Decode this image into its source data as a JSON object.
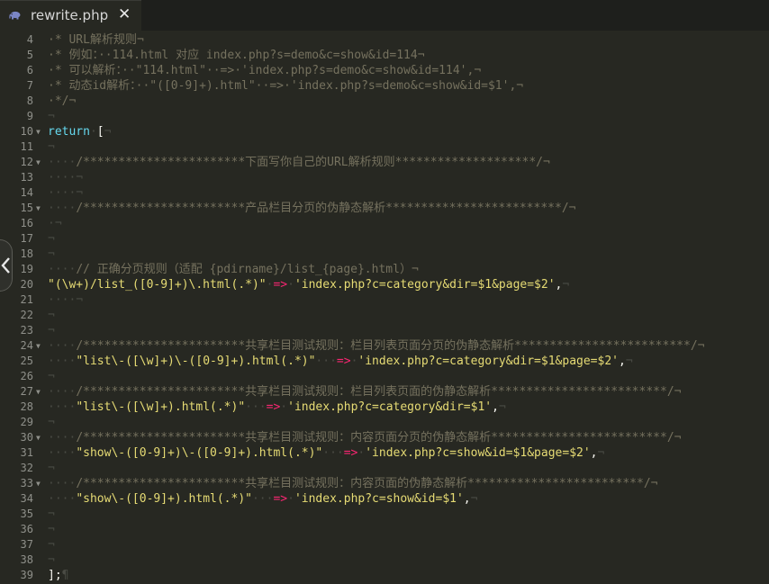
{
  "tab": {
    "filename": "rewrite.php",
    "icon": "php-elephant-icon",
    "close_label": "✕"
  },
  "theme": {
    "background": "#272822",
    "comment": "#75715e",
    "keyword": "#66d9ef",
    "string": "#e6db74",
    "operator": "#f92672"
  },
  "lines": [
    {
      "num": "4",
      "fold": "",
      "tokens": [
        [
          "cm",
          "·* URL解析规则¬"
        ]
      ]
    },
    {
      "num": "5",
      "fold": "",
      "tokens": [
        [
          "cm",
          "·* 例如：··114.html 对应 index.php?s=demo&c=show&id=114¬"
        ]
      ]
    },
    {
      "num": "6",
      "fold": "",
      "tokens": [
        [
          "cm",
          "·* 可以解析：··\"114.html\"··=>·'index.php?s=demo&c=show&id=114',¬"
        ]
      ]
    },
    {
      "num": "7",
      "fold": "",
      "tokens": [
        [
          "cm",
          "·* 动态id解析：··\"([0-9]+).html\"··=>·'index.php?s=demo&c=show&id=$1',¬"
        ]
      ]
    },
    {
      "num": "8",
      "fold": "",
      "tokens": [
        [
          "cm",
          "·*/¬"
        ]
      ]
    },
    {
      "num": "9",
      "fold": "",
      "tokens": [
        [
          "ws",
          "¬"
        ]
      ]
    },
    {
      "num": "10",
      "fold": "▼",
      "tokens": [
        [
          "kw",
          "return"
        ],
        [
          "ws",
          "·"
        ],
        [
          "p",
          "["
        ],
        [
          "ws",
          "¬"
        ]
      ]
    },
    {
      "num": "11",
      "fold": "",
      "tokens": [
        [
          "ws",
          "¬"
        ]
      ]
    },
    {
      "num": "12",
      "fold": "▼",
      "tokens": [
        [
          "ws",
          "····"
        ],
        [
          "cm",
          "/***********************下面写你自己的URL解析规则********************/¬"
        ]
      ]
    },
    {
      "num": "13",
      "fold": "",
      "tokens": [
        [
          "ws",
          "····¬"
        ]
      ]
    },
    {
      "num": "14",
      "fold": "",
      "tokens": [
        [
          "ws",
          "····¬"
        ]
      ]
    },
    {
      "num": "15",
      "fold": "▼",
      "tokens": [
        [
          "ws",
          "····"
        ],
        [
          "cm",
          "/***********************产品栏目分页的伪静态解析*************************/¬"
        ]
      ]
    },
    {
      "num": "16",
      "fold": "",
      "tokens": [
        [
          "ws",
          "·¬"
        ]
      ]
    },
    {
      "num": "17",
      "fold": "",
      "tokens": [
        [
          "ws",
          "¬"
        ]
      ]
    },
    {
      "num": "18",
      "fold": "",
      "tokens": [
        [
          "ws",
          "¬"
        ]
      ]
    },
    {
      "num": "19",
      "fold": "",
      "tokens": [
        [
          "ws",
          "····"
        ],
        [
          "cm",
          "// 正确分页规则（适配 {pdirname}/list_{page}.html）¬"
        ]
      ]
    },
    {
      "num": "20",
      "fold": "",
      "tokens": [
        [
          "s",
          "\"(\\w+)/list_([0-9]+)\\.html(.*)\""
        ],
        [
          "ws",
          "·"
        ],
        [
          "op",
          "=>"
        ],
        [
          "ws",
          "·"
        ],
        [
          "s",
          "'index.php?c=category&dir=$1&page=$2'"
        ],
        [
          "p",
          ","
        ],
        [
          "ws",
          "¬"
        ]
      ]
    },
    {
      "num": "21",
      "fold": "",
      "tokens": [
        [
          "ws",
          "····¬"
        ]
      ]
    },
    {
      "num": "22",
      "fold": "",
      "tokens": [
        [
          "ws",
          "¬"
        ]
      ]
    },
    {
      "num": "23",
      "fold": "",
      "tokens": [
        [
          "ws",
          "¬"
        ]
      ]
    },
    {
      "num": "24",
      "fold": "▼",
      "tokens": [
        [
          "ws",
          "····"
        ],
        [
          "cm",
          "/***********************共享栏目测试规则：栏目列表页面分页的伪静态解析*************************/¬"
        ]
      ]
    },
    {
      "num": "25",
      "fold": "",
      "tokens": [
        [
          "ws",
          "····"
        ],
        [
          "s",
          "\"list\\-([\\w]+)\\-([0-9]+).html(.*)\""
        ],
        [
          "ws",
          "···"
        ],
        [
          "op",
          "=>"
        ],
        [
          "ws",
          "·"
        ],
        [
          "s",
          "'index.php?c=category&dir=$1&page=$2'"
        ],
        [
          "p",
          ","
        ],
        [
          "ws",
          "¬"
        ]
      ]
    },
    {
      "num": "26",
      "fold": "",
      "tokens": [
        [
          "ws",
          "¬"
        ]
      ]
    },
    {
      "num": "27",
      "fold": "▼",
      "tokens": [
        [
          "ws",
          "····"
        ],
        [
          "cm",
          "/***********************共享栏目测试规则：栏目列表页面的伪静态解析*************************/¬"
        ]
      ]
    },
    {
      "num": "28",
      "fold": "",
      "tokens": [
        [
          "ws",
          "····"
        ],
        [
          "s",
          "\"list\\-([\\w]+).html(.*)\""
        ],
        [
          "ws",
          "···"
        ],
        [
          "op",
          "=>"
        ],
        [
          "ws",
          "·"
        ],
        [
          "s",
          "'index.php?c=category&dir=$1'"
        ],
        [
          "p",
          ","
        ],
        [
          "ws",
          "¬"
        ]
      ]
    },
    {
      "num": "29",
      "fold": "",
      "tokens": [
        [
          "ws",
          "¬"
        ]
      ]
    },
    {
      "num": "30",
      "fold": "▼",
      "tokens": [
        [
          "ws",
          "····"
        ],
        [
          "cm",
          "/***********************共享栏目测试规则：内容页面分页的伪静态解析*************************/¬"
        ]
      ]
    },
    {
      "num": "31",
      "fold": "",
      "tokens": [
        [
          "ws",
          "····"
        ],
        [
          "s",
          "\"show\\-([0-9]+)\\-([0-9]+).html(.*)\""
        ],
        [
          "ws",
          "···"
        ],
        [
          "op",
          "=>"
        ],
        [
          "ws",
          "·"
        ],
        [
          "s",
          "'index.php?c=show&id=$1&page=$2'"
        ],
        [
          "p",
          ","
        ],
        [
          "ws",
          "¬"
        ]
      ]
    },
    {
      "num": "32",
      "fold": "",
      "tokens": [
        [
          "ws",
          "¬"
        ]
      ]
    },
    {
      "num": "33",
      "fold": "▼",
      "tokens": [
        [
          "ws",
          "····"
        ],
        [
          "cm",
          "/***********************共享栏目测试规则：内容页面的伪静态解析*************************/¬"
        ]
      ]
    },
    {
      "num": "34",
      "fold": "",
      "tokens": [
        [
          "ws",
          "····"
        ],
        [
          "s",
          "\"show\\-([0-9]+).html(.*)\""
        ],
        [
          "ws",
          "···"
        ],
        [
          "op",
          "=>"
        ],
        [
          "ws",
          "·"
        ],
        [
          "s",
          "'index.php?c=show&id=$1'"
        ],
        [
          "p",
          ","
        ],
        [
          "ws",
          "¬"
        ]
      ]
    },
    {
      "num": "35",
      "fold": "",
      "tokens": [
        [
          "ws",
          "¬"
        ]
      ]
    },
    {
      "num": "36",
      "fold": "",
      "tokens": [
        [
          "ws",
          "¬"
        ]
      ]
    },
    {
      "num": "37",
      "fold": "",
      "tokens": [
        [
          "ws",
          "¬"
        ]
      ]
    },
    {
      "num": "38",
      "fold": "",
      "tokens": [
        [
          "ws",
          "¬"
        ]
      ]
    },
    {
      "num": "39",
      "fold": "",
      "tokens": [
        [
          "p",
          "];"
        ],
        [
          "ws",
          "¶"
        ]
      ]
    }
  ]
}
